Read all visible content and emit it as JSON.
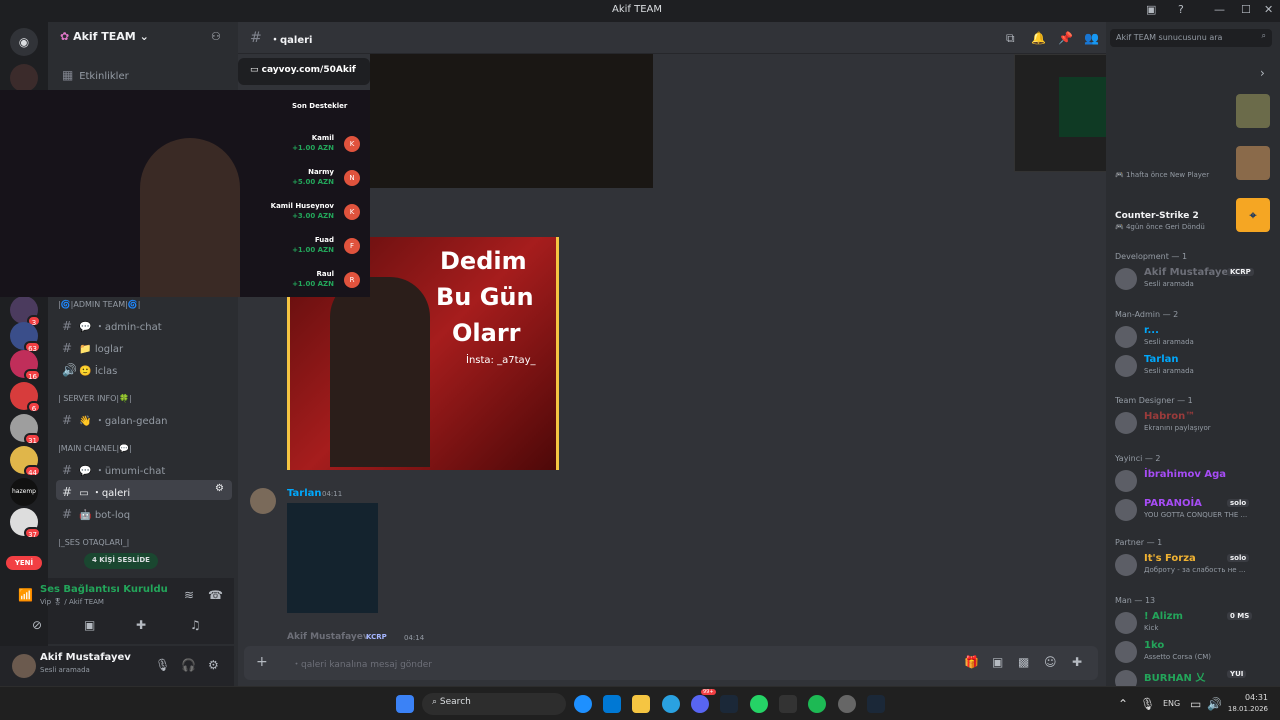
{
  "window": {
    "title": "Akif TEAM"
  },
  "server": {
    "name": "Akif TEAM",
    "events_label": "Etkinlikler"
  },
  "overlay": {
    "url": "cayvoy.com/50Akif",
    "donations_title": "Son Destekler",
    "donations": [
      {
        "name": "Kamil",
        "amount": "+1.00 AZN",
        "initial": "K"
      },
      {
        "name": "Narmy",
        "amount": "+5.00 AZN",
        "initial": "N"
      },
      {
        "name": "Kamil Huseynov",
        "amount": "+3.00 AZN",
        "initial": "K"
      },
      {
        "name": "Fuad",
        "amount": "+1.00 AZN",
        "initial": "F"
      },
      {
        "name": "Raul",
        "amount": "+1.00 AZN",
        "initial": "R"
      }
    ]
  },
  "server_badges": [
    "3",
    "63",
    "16",
    "6",
    "31",
    "44",
    "37"
  ],
  "server_new_label": "YENİ",
  "categories": {
    "admin": "|🌀|ADMIN TEAM|🌀|",
    "serverinfo": "| SERVER INFO|🍀|",
    "main": "|MAIN CHANEL|💬|",
    "ses": "|_SES OTAQLARI_|"
  },
  "channels": {
    "admin_chat": "・admin-chat",
    "loglar": "loglar",
    "iclas": "İclas",
    "galan_gedan": "・galan-gedan",
    "umumi_chat": "・ümumi-chat",
    "qaleri": "・qaleri",
    "bot_loq": "bot-loq"
  },
  "voice_pill": "4 KİŞİ SESLİDE",
  "voice": {
    "status": "Ses Bağlantısı Kuruldu",
    "sub": "Vip 🎖 / Akif TEAM"
  },
  "user": {
    "name": "Akif Mustafayev",
    "status": "Sesli aramada"
  },
  "header": {
    "channel": "・qaleri",
    "search_placeholder": "Akif TEAM sunucusunu ara"
  },
  "thumbnail": {
    "line1": "Dedim",
    "line2": "Bu Gün",
    "line3": "Olarr",
    "insta": "İnsta: _a7tay_"
  },
  "messages": [
    {
      "author": "Tarlan",
      "time": "04:11"
    },
    {
      "author": "Akif Mustafayev",
      "tag": "KCRP",
      "time": "04:14"
    }
  ],
  "composer": {
    "placeholder": "・qaleri kanalına mesaj gönder"
  },
  "members": {
    "activity1": {
      "time": "1hafta önce",
      "note": "New Player"
    },
    "activity2": {
      "title": "Counter-Strike 2",
      "time": "4gün önce",
      "note": "Geri Döndü"
    },
    "groups": [
      {
        "title": "Development — 1",
        "items": [
          {
            "name": "Akif Mustafayev",
            "tag": "KCRP",
            "status": "Sesli aramada",
            "color": "#6d6f78"
          }
        ]
      },
      {
        "title": "Man-Admin — 2",
        "items": [
          {
            "name": "r...",
            "status": "Sesli aramada",
            "color": "#00a8fc"
          },
          {
            "name": "Tarlan",
            "status": "Sesli aramada",
            "color": "#00a8fc"
          }
        ]
      },
      {
        "title": "Team Designer — 1",
        "items": [
          {
            "name": "Habron™",
            "status": "Ekranını paylaşıyor",
            "color": "#9b3b3b"
          }
        ]
      },
      {
        "title": "Yayinci — 2",
        "items": [
          {
            "name": "İbrahimov Aga",
            "status": "",
            "color": "#a64cf5"
          },
          {
            "name": "PARANOİA",
            "tag": "solo",
            "status": "YOU GOTTA CONQUER THE ...",
            "color": "#a64cf5"
          }
        ]
      },
      {
        "title": "Partner — 1",
        "items": [
          {
            "name": "It's Forza",
            "tag": "solo",
            "status": "Доброту - за слабость не ...",
            "color": "#f0b232"
          }
        ]
      },
      {
        "title": "Man — 13",
        "items": [
          {
            "name": "! Alizm",
            "tag": "0 MS",
            "status": "Kick",
            "color": "#23a55a"
          },
          {
            "name": "1ko",
            "status": "Assetto Corsa (CM)",
            "color": "#23a55a"
          },
          {
            "name": "BURHAN 乂",
            "tag": "YUI",
            "status": "",
            "color": "#23a55a"
          }
        ]
      }
    ]
  },
  "taskbar": {
    "search": "Search",
    "lang": "ENG",
    "time": "04:31",
    "date": "18.01.2026",
    "discord_badge": "99+"
  },
  "colors": {
    "accent": "#5865f2",
    "online": "#23a55a",
    "danger": "#f23f43",
    "bg": "#313338"
  }
}
